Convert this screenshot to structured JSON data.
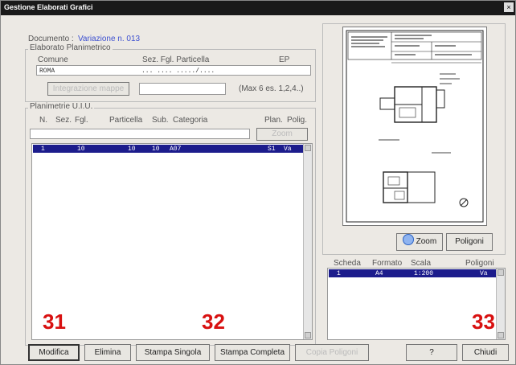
{
  "window": {
    "title": "Gestione Elaborati Grafici",
    "close": "×"
  },
  "documento": {
    "label": "Documento :",
    "value": "Variazione n. 013"
  },
  "elaborato": {
    "group_title": "Elaborato Planimetrico",
    "headers": {
      "comune": "Comune",
      "sez_fgl_part": "Sez. Fgl. Particella",
      "ep": "EP"
    },
    "comune_value": "ROMA",
    "particella_value": "... .... ...../....",
    "integrazione_button": "Integrazione mappe",
    "max_note": "(Max 6 es. 1,2,4..)"
  },
  "planimetrie": {
    "group_title": "Planimetrie U.I.U.",
    "headers": {
      "n": "N.",
      "sez": "Sez.",
      "fgl": "Fgl.",
      "particella": "Particella",
      "sub": "Sub.",
      "categoria": "Categoria",
      "plan": "Plan.",
      "polig": "Polig."
    },
    "zoom_button": "Zoom",
    "rows": [
      {
        "n": "1",
        "fgl": "10",
        "particella": "10",
        "sub": "10",
        "categoria": "A07",
        "plan": "S1",
        "polig": "Va"
      }
    ]
  },
  "preview": {
    "zoom_button": "Zoom",
    "poligoni_button": "Poligoni"
  },
  "schede": {
    "headers": {
      "scheda": "Scheda",
      "formato": "Formato",
      "scala": "Scala",
      "poligoni": "Poligoni"
    },
    "rows": [
      {
        "scheda": "1",
        "formato": "A4",
        "scala": "1:200",
        "poligoni": "Va"
      }
    ]
  },
  "annotations": [
    "31",
    "32",
    "33"
  ],
  "toolbar": {
    "modifica": "Modifica",
    "elimina": "Elimina",
    "stampa_singola": "Stampa Singola",
    "stampa_completa": "Stampa Completa",
    "copia_poligoni": "Copia Poligoni",
    "help": "?",
    "chiudi": "Chiudi"
  },
  "colors": {
    "selection": "#1c1c8c",
    "annotation": "#d81010",
    "title_bar": "#1a1a1a"
  }
}
